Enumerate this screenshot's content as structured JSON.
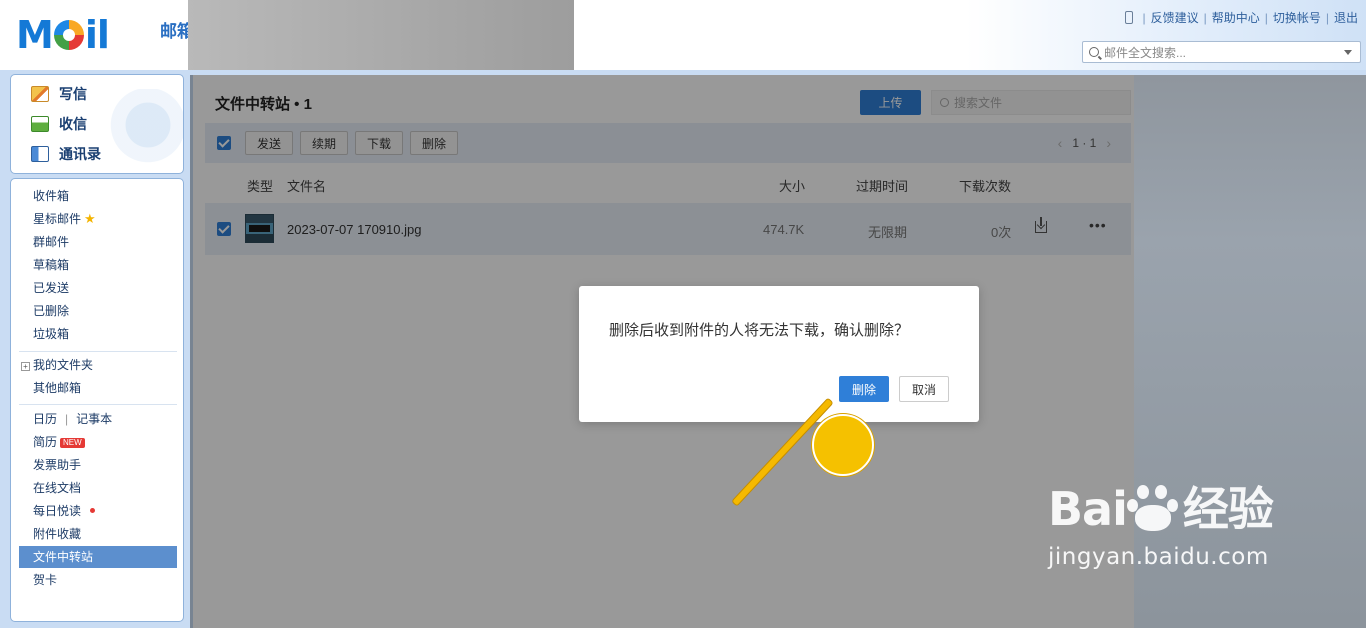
{
  "header": {
    "logo_text_before": "M",
    "logo_text_after": "il",
    "logo_sub": "邮箱",
    "links": [
      "反馈建议",
      "帮助中心",
      "切换帐号",
      "退出"
    ],
    "search_placeholder": "邮件全文搜索..."
  },
  "sidebar": {
    "actions": [
      {
        "label": "写信",
        "icon": "pencil-icon"
      },
      {
        "label": "收信",
        "icon": "inbox-download-icon"
      },
      {
        "label": "通讯录",
        "icon": "contacts-card-icon"
      }
    ],
    "folders": [
      "收件箱",
      "星标邮件",
      "群邮件",
      "草稿箱",
      "已发送",
      "已删除",
      "垃圾箱"
    ],
    "my_folders": "我的文件夹",
    "other_mailbox": "其他邮箱",
    "calendar": "日历",
    "notes": "记事本",
    "resume": "简历",
    "resume_badge": "NEW",
    "tools": [
      "发票助手",
      "在线文档",
      "每日悦读",
      "附件收藏",
      "文件中转站",
      "贺卡"
    ],
    "active_item": "文件中转站"
  },
  "main": {
    "title": "文件中转站",
    "title_count": "1",
    "upload_label": "上传",
    "search_placeholder": "搜索文件",
    "toolbar": {
      "send": "发送",
      "renew": "续期",
      "download": "下载",
      "delete": "删除",
      "page_info": "1 · 1"
    },
    "columns": {
      "type": "类型",
      "name": "文件名",
      "size": "大小",
      "expiry": "过期时间",
      "downloads": "下载次数"
    },
    "files": [
      {
        "name": "2023-07-07 170910.jpg",
        "size": "474.7K",
        "expiry": "无限期",
        "downloads": "0次"
      }
    ]
  },
  "dialog": {
    "message": "删除后收到附件的人将无法下载，确认删除？",
    "confirm_label": "删除",
    "cancel_label": "取消"
  },
  "watermark": {
    "brand_left": "Bai",
    "brand_right": "经验",
    "paw_text": "du",
    "url": "jingyan.baidu.com"
  },
  "colors": {
    "primary": "#2f7fd8",
    "pointer": "#f5c100",
    "sidebar_active": "#5c8fce"
  }
}
